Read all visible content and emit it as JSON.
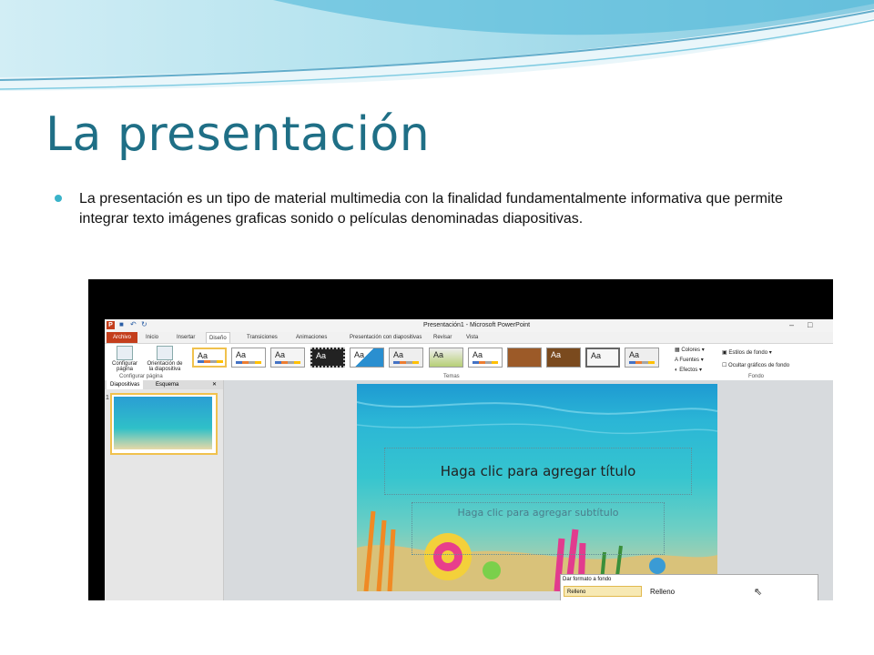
{
  "slide": {
    "title": "La presentación",
    "bullet": "La presentación es un tipo de material multimedia con la finalidad fundamentalmente informativa que permite integrar texto imágenes graficas sonido o películas denominadas diapositivas."
  },
  "colors": {
    "title": "#1f6f86",
    "bullet": "#3ab3c9",
    "accent_file": "#c43e1c"
  },
  "ppt": {
    "window_title": "Presentación1  -  Microsoft PowerPoint",
    "qat_icons": [
      "ppt-icon",
      "save-icon",
      "undo-icon",
      "redo-icon"
    ],
    "tabs": [
      "Archivo",
      "Inicio",
      "Insertar",
      "Diseño",
      "Transiciones",
      "Animaciones",
      "Presentación con diapositivas",
      "Revisar",
      "Vista"
    ],
    "active_tab": "Diseño",
    "ribbon": {
      "config_page": "Configurar página",
      "orientation": "Orientación de la diapositiva",
      "group_config": "Configurar página",
      "themes_group": "Temas",
      "theme_label": "Aa",
      "colors": "Colores",
      "fonts": "Fuentes",
      "effects": "Efectos",
      "bg_styles": "Estilos de fondo",
      "hide_bg": "Ocultar gráficos de fondo",
      "fondo_group": "Fondo"
    },
    "pane_tabs": [
      "Diapositivas",
      "Esquema"
    ],
    "slide_number": "1",
    "placeholder_title": "Haga clic para agregar título",
    "placeholder_subtitle": "Haga clic para agregar subtítulo",
    "dialog": {
      "title": "Dar formato a fondo",
      "list_item": "Relleno",
      "section": "Relleno"
    }
  }
}
